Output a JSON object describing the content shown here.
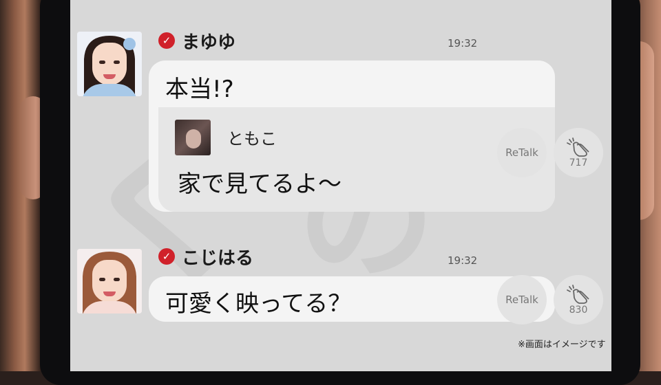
{
  "messages": [
    {
      "sender": "まゆゆ",
      "time": "19:32",
      "text": "本当!?",
      "quote": {
        "name": "ともこ",
        "text": "家で見てるよ〜"
      },
      "retalk_label": "ReTalk",
      "clap_count": "717"
    },
    {
      "sender": "こじはる",
      "time": "19:32",
      "text": "可愛く映ってる？",
      "retalk_label": "ReTalk",
      "clap_count": "830"
    }
  ],
  "disclaimer": "※画面はイメージです",
  "icons": {
    "verified": "verified-check-icon",
    "clap": "clap-icon"
  },
  "colors": {
    "verified_badge": "#d0212a",
    "screen_bg": "#d8d8d8",
    "bubble_bg": "#f4f4f4",
    "quote_bg": "#e6e6e6"
  }
}
